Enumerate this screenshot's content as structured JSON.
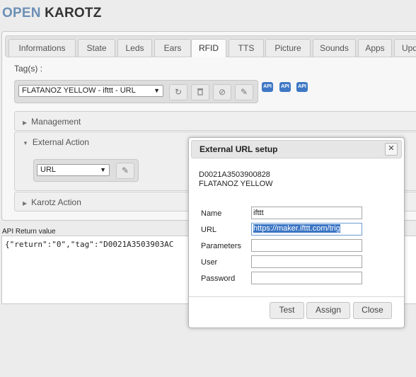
{
  "header": {
    "logo_open": "OPEN",
    "logo_karotz": "KAROTZ"
  },
  "tabs": [
    {
      "label": "Informations"
    },
    {
      "label": "State"
    },
    {
      "label": "Leds"
    },
    {
      "label": "Ears"
    },
    {
      "label": "RFID",
      "active": true
    },
    {
      "label": "TTS"
    },
    {
      "label": "Picture"
    },
    {
      "label": "Sounds"
    },
    {
      "label": "Apps"
    },
    {
      "label": "Upd"
    }
  ],
  "rfid": {
    "tags_label": "Tag(s) :",
    "tag_select": "FLATANOZ YELLOW - ifttt - URL",
    "api_badges": [
      "API",
      "API",
      "API"
    ],
    "icons": [
      "refresh-icon",
      "trash-icon",
      "ban-icon",
      "pencil-icon"
    ]
  },
  "sections": {
    "management": {
      "label": "Management",
      "expanded": false
    },
    "external_action": {
      "label": "External Action",
      "expanded": true,
      "select": "URL"
    },
    "karotz_action": {
      "label": "Karotz Action",
      "expanded": false
    }
  },
  "api_return": {
    "label": "API Return value",
    "text": "{\"return\":\"0\",\"tag\":\"D0021A3503903AC"
  },
  "dialog": {
    "title": "External URL setup",
    "close": "✕",
    "tag_id": "D0021A3503900828",
    "tag_name": "FLATANOZ YELLOW",
    "fields": {
      "name": {
        "label": "Name",
        "value": "ifttt"
      },
      "url": {
        "label": "URL",
        "value": "https://maker.ifttt.com/trig"
      },
      "parameters": {
        "label": "Parameters",
        "value": ""
      },
      "user": {
        "label": "User",
        "value": ""
      },
      "password": {
        "label": "Password",
        "value": ""
      }
    },
    "buttons": {
      "test": "Test",
      "assign": "Assign",
      "close": "Close"
    }
  },
  "colors": {
    "logo_open": "#6c8fb5",
    "api_badge": "#3f78c4",
    "selection": "#3a75c4"
  }
}
